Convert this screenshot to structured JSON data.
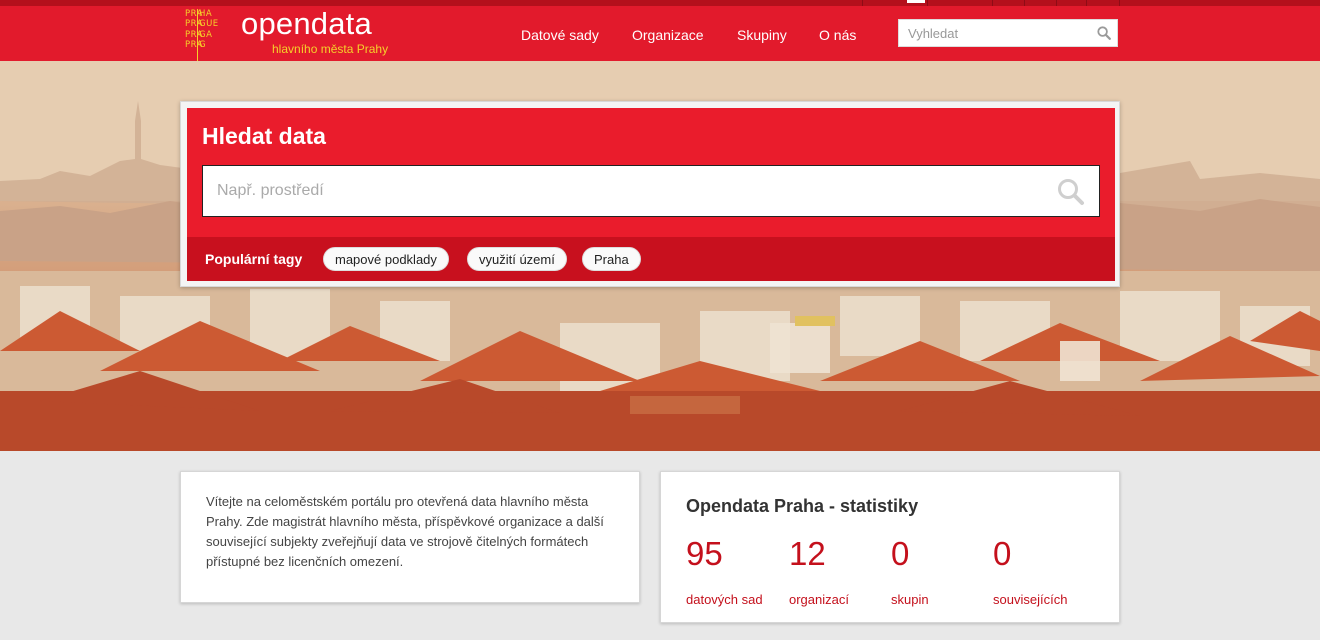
{
  "header": {
    "logo_mark_rows": [
      [
        "PRA",
        "HA"
      ],
      [
        "PRA",
        "GUE"
      ],
      [
        "PRA",
        "GA"
      ],
      [
        "PRA",
        "G"
      ]
    ],
    "logo_title": "opendata",
    "logo_subtitle": "hlavního města Prahy",
    "nav": [
      "Datové sady",
      "Organizace",
      "Skupiny",
      "O nás"
    ],
    "search_placeholder": "Vyhledat",
    "search_icon": "search-icon",
    "brand_color": "#e21a2c",
    "accent_color": "#f5d12a"
  },
  "hero": {
    "title": "Hledat data",
    "search_placeholder": "Např. prostředí",
    "search_icon": "search-icon",
    "popular_tags_label": "Populární tagy",
    "tags": [
      "mapové podklady",
      "využití území",
      "Praha"
    ]
  },
  "welcome": {
    "text": "Vítejte na celoměstském portálu pro otevřená data hlavního města Prahy. Zde magistrát hlavního města, příspěvkové organizace a další související subjekty zveřejňují data ve strojově čitelných formátech přístupné bez licenčních omezení."
  },
  "stats": {
    "title": "Opendata Praha - statistiky",
    "items": [
      {
        "value": "95",
        "label": "datových sad"
      },
      {
        "value": "12",
        "label": "organizací"
      },
      {
        "value": "0",
        "label": "skupin"
      },
      {
        "value": "0",
        "label": "souvisejících"
      }
    ],
    "stat_color": "#c4101c"
  }
}
